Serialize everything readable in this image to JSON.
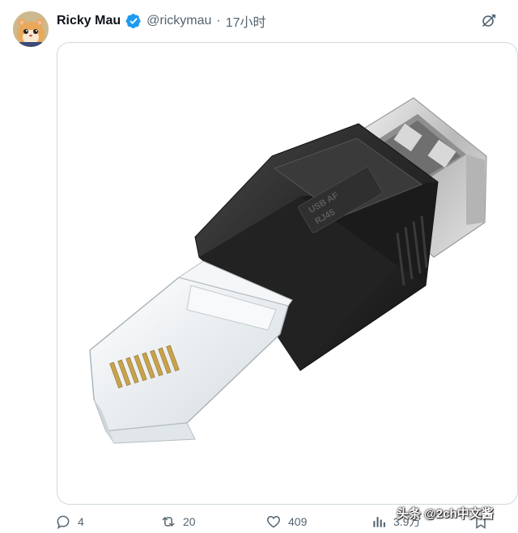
{
  "tweet": {
    "author_name": "Ricky Mau",
    "handle": "@rickymau",
    "separator": "·",
    "timestamp": "17小时",
    "verified": true
  },
  "media": {
    "alt": "RJ45 to USB-A female adapter"
  },
  "actions": {
    "replies": "4",
    "retweets": "20",
    "likes": "409",
    "views": "3.9万"
  },
  "watermark": "头条 @2ch中文酱",
  "colors": {
    "text_secondary": "#536471",
    "verified_blue": "#1d9bf0",
    "border": "#cfd9de"
  },
  "icons": [
    "grok-icon",
    "reply-icon",
    "retweet-icon",
    "like-icon",
    "views-icon",
    "verified-badge-icon"
  ]
}
